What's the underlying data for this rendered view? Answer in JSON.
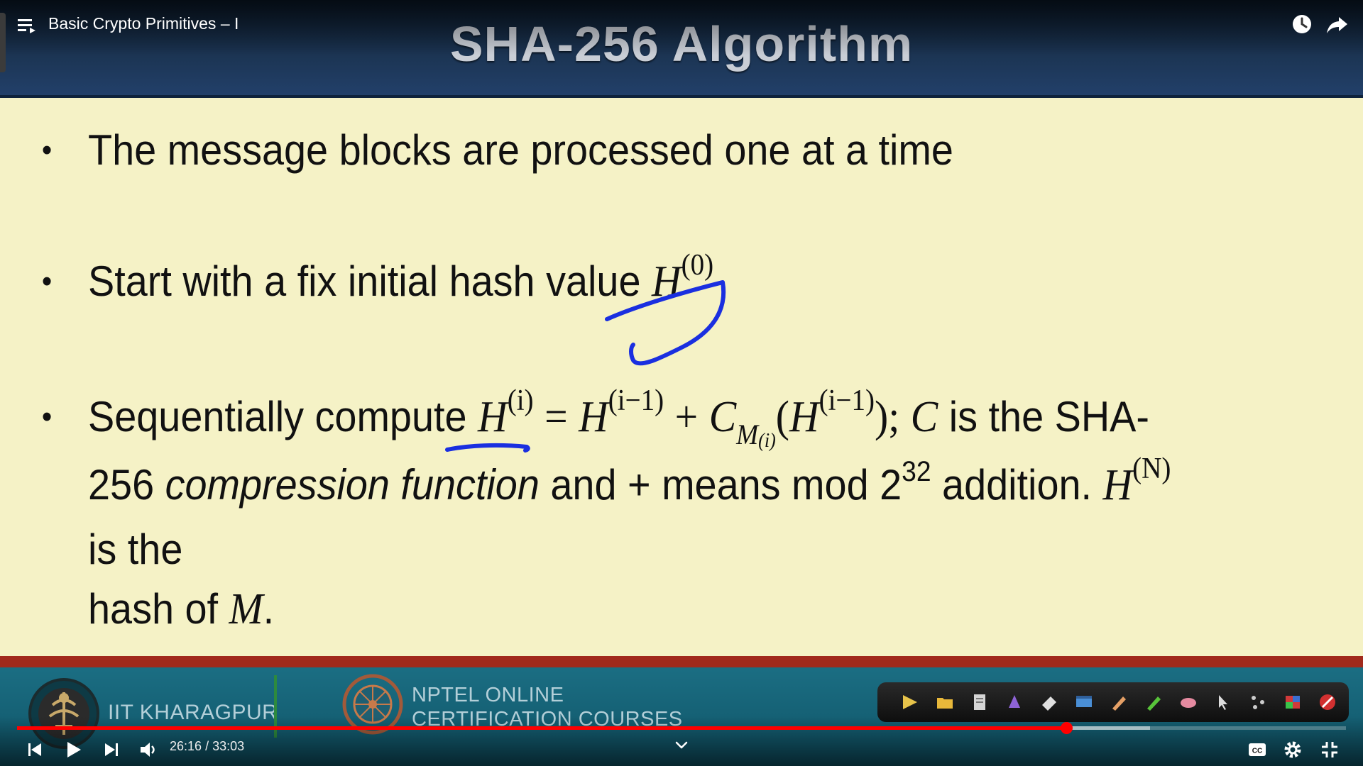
{
  "player": {
    "title": "Basic Crypto Primitives – I",
    "time_current": "26:16",
    "time_separator": "/",
    "time_total": "33:03",
    "progress_fraction": 0.7896,
    "buffered_fraction": 0.8528,
    "colors": {
      "progress": "#ff0000",
      "text": "#ffffff"
    },
    "icons": [
      "playlist-icon",
      "clock-icon",
      "share-icon",
      "previous-icon",
      "play-icon",
      "next-icon",
      "volume-icon",
      "chevron-down-icon",
      "captions-icon",
      "settings-icon",
      "fullscreen-exit-icon"
    ]
  },
  "slide": {
    "title": "SHA-256 Algorithm",
    "bullet1": "The message blocks are processed one at a time",
    "bullet2": {
      "text": "Start with a fix initial hash value",
      "math_base": "H",
      "math_sup": "(0)"
    },
    "bullet3": {
      "lead": "Sequentially compute",
      "h": "H",
      "sup_i": "(i)",
      "equals": "=",
      "h2": "H",
      "sup_im1": "(i−1)",
      "plus": "+",
      "c": "C",
      "sub_m": "M",
      "sub_m_sup": "(i)",
      "open_paren": "(",
      "h3": "H",
      "sup_im1_b": "(i−1)",
      "close_paren": ");",
      "c2": "C",
      "is_the": "is the SHA-",
      "line2_num": "256",
      "compression": "compression function",
      "and_plus": "and + means mod 2",
      "exp": "32",
      "addition": "addition.",
      "hn": "H",
      "sup_n": "(N)",
      "is_the2": "is the",
      "line3": "hash of",
      "m": "M",
      "period": "."
    },
    "colors": {
      "background": "#f5f2c6",
      "header": "#1c3554",
      "title": "#c9ced6",
      "ink": "#1a2fe0"
    }
  },
  "footer": {
    "iit": "IIT KHARAGPUR",
    "nptel_line1": "NPTEL ONLINE",
    "nptel_line2": "CERTIFICATION COURSES",
    "colors": {
      "banner": "#1b6e83",
      "stripe": "#a12a1c"
    },
    "toolbar_icons": [
      "arrow-tool-icon",
      "folder-tool-icon",
      "page-tool-icon",
      "marker-tool-icon",
      "eraser-tool-icon",
      "screen-tool-icon",
      "pen-tool-icon",
      "highlighter-tool-icon",
      "clear-tool-icon",
      "pointer-tool-icon",
      "settings-tool-icon",
      "color-palette-icon",
      "close-tool-icon"
    ]
  }
}
